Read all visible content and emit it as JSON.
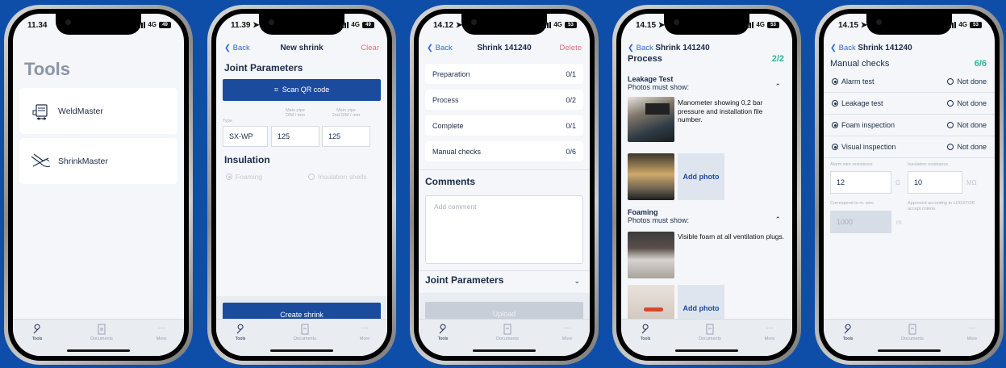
{
  "colors": {
    "background": "#0f4ea8",
    "primary": "#1b4b9d",
    "link": "#2a6ddb",
    "danger": "#ea6a7d",
    "success": "#33b39a"
  },
  "tabbar": {
    "tools": "Tools",
    "documents": "Documents",
    "more": "More"
  },
  "network": "4G",
  "screen1": {
    "time": "11.34",
    "battery": "49",
    "title": "Tools",
    "items": [
      {
        "label": "WeldMaster",
        "icon": "weld-machine-icon"
      },
      {
        "label": "ShrinkMaster",
        "icon": "shrink-torch-icon"
      }
    ]
  },
  "screen2": {
    "time": "11.39",
    "battery": "49",
    "back": "Back",
    "title": "New shrink",
    "clear": "Clear",
    "joint_heading": "Joint Parameters",
    "scan_label": "Scan QR code",
    "labels": {
      "type": "Type",
      "main": "Main pipe\nDIM / mm",
      "main2": "Main pipe\n2nd DIM / mm"
    },
    "values": {
      "type": "SX-WP",
      "main": "125",
      "main2": "125"
    },
    "insulation_heading": "Insulation",
    "foaming": "Foaming",
    "shells": "Insulation shells",
    "create": "Create shrink"
  },
  "screen3": {
    "time": "14.12",
    "battery": "53",
    "back": "Back",
    "title": "Shrink 141240",
    "delete": "Delete",
    "rows": [
      {
        "label": "Preparation",
        "count": "0/1"
      },
      {
        "label": "Process",
        "count": "0/2"
      },
      {
        "label": "Complete",
        "count": "0/1"
      },
      {
        "label": "Manual checks",
        "count": "0/6"
      }
    ],
    "comments_heading": "Comments",
    "comment_placeholder": "Add comment",
    "joint_heading": "Joint Parameters",
    "upload": "Upload"
  },
  "screen4": {
    "time": "14.15",
    "battery": "53",
    "back": "Back",
    "title": "Shrink 141240",
    "process": "Process",
    "progress": "2/2",
    "leak_title": "Leakage Test",
    "leak_sub": "Photos must show:",
    "leak_desc": "Manometer showing 0,2 bar pressure and installation file number.",
    "add_photo": "Add photo",
    "foam_title": "Foaming",
    "foam_sub": "Photos must show:",
    "foam_desc": "Visible foam at all ventilation plugs.",
    "add_photo2": "Add photo"
  },
  "screen5": {
    "time": "14.15",
    "battery": "53",
    "back": "Back",
    "title": "Shrink 141240",
    "heading": "Manual checks",
    "progress": "6/6",
    "checks": [
      {
        "label": "Alarm test",
        "alt": "Not done"
      },
      {
        "label": "Leakage test",
        "alt": "Not done"
      },
      {
        "label": "Foam inspection",
        "alt": "Not done"
      },
      {
        "label": "Visual inspection",
        "alt": "Not done"
      }
    ],
    "alarm_label": "Alarm wire resistance",
    "alarm_value": "12",
    "alarm_unit": "Ω",
    "ins_label": "Insulation resistance",
    "ins_value": "10",
    "ins_unit": "MΩ",
    "corr_label": "Correspond to m. wire",
    "corr_value": "1000",
    "corr_unit": "m",
    "approved": "Approved according to LOGSTOR accept criteria"
  }
}
